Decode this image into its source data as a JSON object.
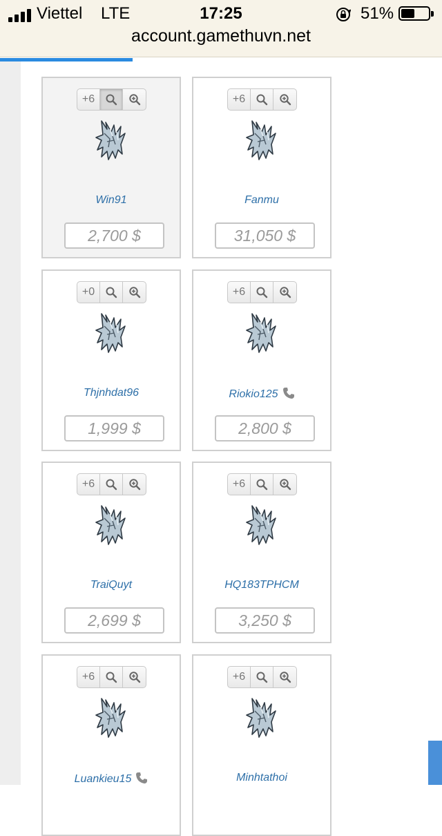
{
  "status_bar": {
    "carrier": "Viettel",
    "network": "LTE",
    "time": "17:25",
    "battery_percent": "51%",
    "battery_level": 0.51
  },
  "browser": {
    "url": "account.gamethuvn.net"
  },
  "cards": [
    {
      "level": "+6",
      "seller": "Win91",
      "price": "2,700 $",
      "has_phone": false,
      "active": true
    },
    {
      "level": "+6",
      "seller": "Fanmu",
      "price": "31,050 $",
      "has_phone": false,
      "active": false
    },
    {
      "level": "+0",
      "seller": "Thjnhdat96",
      "price": "1,999 $",
      "has_phone": false,
      "active": false
    },
    {
      "level": "+6",
      "seller": "Riokio125",
      "price": "2,800 $",
      "has_phone": true,
      "active": false
    },
    {
      "level": "+6",
      "seller": "TraiQuyt",
      "price": "2,699 $",
      "has_phone": false,
      "active": false
    },
    {
      "level": "+6",
      "seller": "HQ183TPHCM",
      "price": "3,250 $",
      "has_phone": false,
      "active": false
    },
    {
      "level": "+6",
      "seller": "Luankieu15",
      "price": "",
      "has_phone": true,
      "active": false
    },
    {
      "level": "+6",
      "seller": "Minhtathoi",
      "price": "",
      "has_phone": false,
      "active": false
    }
  ],
  "icons": {
    "search": "search-icon",
    "zoom": "zoom-in-icon",
    "phone": "phone-icon",
    "item": "winged-item-icon"
  },
  "colors": {
    "link": "#2d6fa8",
    "accent": "#2a8ae0",
    "price_text": "#9a9a9a"
  }
}
